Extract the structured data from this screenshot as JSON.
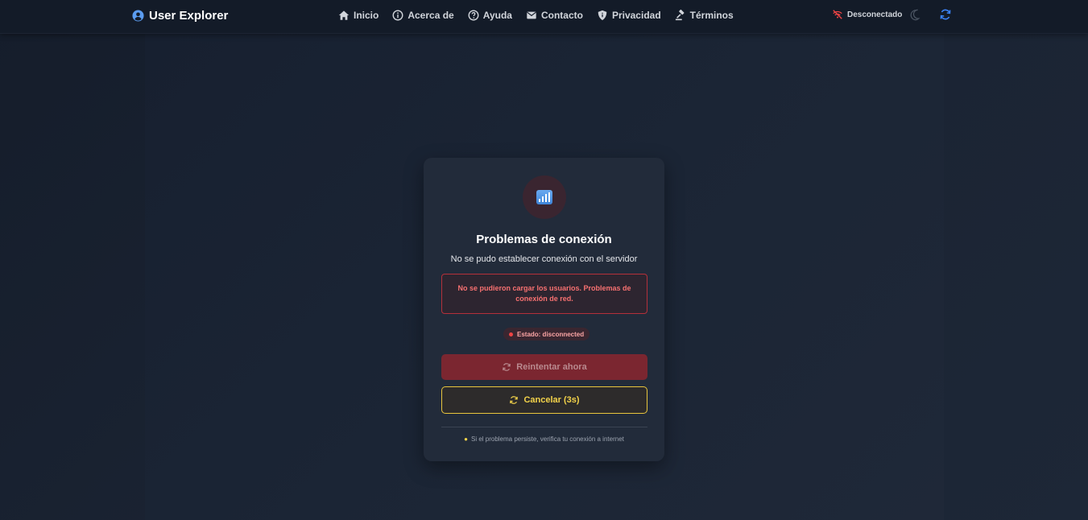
{
  "header": {
    "brand": {
      "label": "User Explorer",
      "icon": "user-circle-icon"
    },
    "nav": [
      {
        "label": "Inicio",
        "icon": "home-icon"
      },
      {
        "label": "Acerca de",
        "icon": "info-icon"
      },
      {
        "label": "Ayuda",
        "icon": "help-icon"
      },
      {
        "label": "Contacto",
        "icon": "mail-icon"
      },
      {
        "label": "Privacidad",
        "icon": "shield-icon"
      },
      {
        "label": "Términos",
        "icon": "gavel-icon"
      }
    ],
    "connection_status": {
      "label": "Desconectado",
      "icon": "wifi-off-icon"
    },
    "theme_toggle": {
      "icon": "moon-icon"
    },
    "refresh": {
      "icon": "refresh-icon"
    }
  },
  "card": {
    "icon": "signal-icon",
    "title": "Problemas de conexión",
    "subtitle": "No se pudo establecer conexión con el servidor",
    "error_message": "No se pudieron cargar los usuarios. Problemas de conexión de red.",
    "status": "Estado: disconnected",
    "retry_label": "Reintentar ahora",
    "cancel_label": "Cancelar (3s)",
    "hint": "Si el problema persiste, verifica tu conexión a internet",
    "hint_icon": "lightbulb-icon"
  },
  "colors": {
    "accent": "#3b82f6",
    "error": "#f87171",
    "warning": "#f3d34a",
    "card_bg": "#222b3a",
    "header_bg": "#131b28"
  }
}
